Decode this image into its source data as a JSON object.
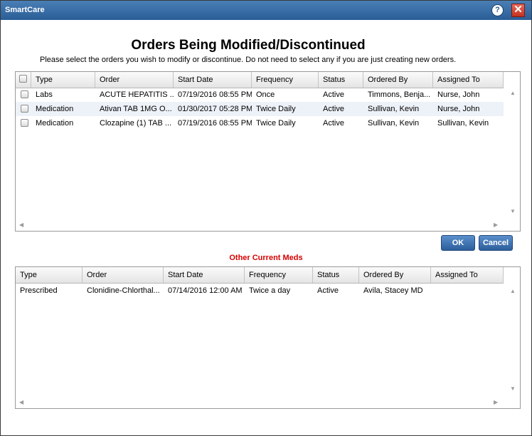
{
  "window": {
    "title": "SmartCare"
  },
  "heading": "Orders Being Modified/Discontinued",
  "subtitle": "Please select the orders you wish to modify or discontinue. Do not need to select any if you are just creating new orders.",
  "orders_grid": {
    "columns": [
      "Type",
      "Order",
      "Start Date",
      "Frequency",
      "Status",
      "Ordered By",
      "Assigned To"
    ],
    "rows": [
      {
        "type": "Labs",
        "order": "ACUTE HEPATITIS ...",
        "start_date": "07/19/2016 08:55 PM",
        "frequency": "Once",
        "status": "Active",
        "ordered_by": "Timmons, Benja...",
        "assigned_to": "Nurse, John"
      },
      {
        "type": "Medication",
        "order": "Ativan TAB 1MG O...",
        "start_date": "01/30/2017 05:28 PM",
        "frequency": "Twice Daily",
        "status": "Active",
        "ordered_by": "Sullivan, Kevin",
        "assigned_to": "Nurse, John"
      },
      {
        "type": "Medication",
        "order": "Clozapine (1) TAB ...",
        "start_date": "07/19/2016 08:55 PM",
        "frequency": "Twice Daily",
        "status": "Active",
        "ordered_by": "Sullivan, Kevin",
        "assigned_to": "Sullivan, Kevin"
      }
    ]
  },
  "buttons": {
    "ok": "OK",
    "cancel": "Cancel"
  },
  "other_meds_label": "Other Current Meds",
  "other_meds_grid": {
    "columns": [
      "Type",
      "Order",
      "Start Date",
      "Frequency",
      "Status",
      "Ordered By",
      "Assigned To"
    ],
    "rows": [
      {
        "type": "Prescribed",
        "order": "Clonidine-Chlorthal...",
        "start_date": "07/14/2016 12:00 AM",
        "frequency": "Twice a day",
        "status": "Active",
        "ordered_by": "Avila, Stacey MD",
        "assigned_to": ""
      }
    ]
  },
  "icons": {
    "help": "help-icon",
    "close": "close-icon"
  },
  "colors": {
    "title_bar": "#2a5d96",
    "accent_red": "#d40000",
    "row_alt": "#edf2f8"
  }
}
